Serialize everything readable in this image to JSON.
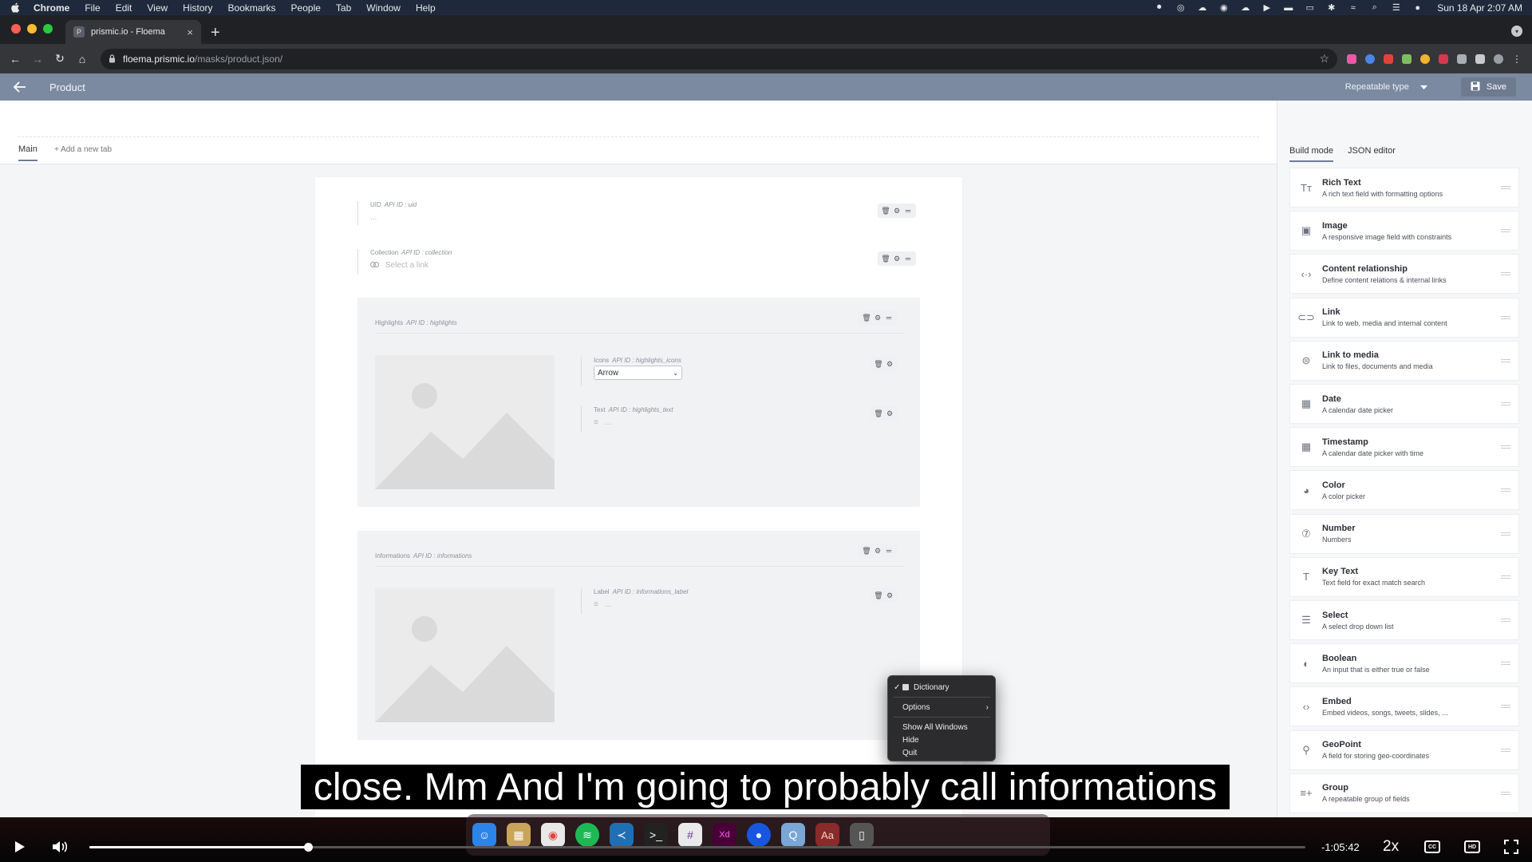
{
  "menubar": {
    "app": "Chrome",
    "items": [
      "File",
      "Edit",
      "View",
      "History",
      "Bookmarks",
      "People",
      "Tab",
      "Window",
      "Help"
    ],
    "clock": "Sun 18 Apr  2:07 AM"
  },
  "browser": {
    "tab_title": "prismic.io - Floema",
    "url_host": "floema.prismic.io",
    "url_path": "/masks/product.json/"
  },
  "header": {
    "title": "Product",
    "type_selector": "Repeatable type",
    "save_label": "Save"
  },
  "editor_tabs": {
    "main": "Main",
    "add": "Add a new tab"
  },
  "fields": {
    "uid": {
      "label": "UID",
      "api": "API ID : uid",
      "value": "..."
    },
    "collection": {
      "label": "Collection",
      "api": "API ID : collection",
      "placeholder": "Select a link"
    },
    "highlights": {
      "label": "Highlights",
      "api": "API ID : highlights",
      "icons": {
        "label": "Icons",
        "api": "API ID : highlights_icons",
        "value": "Arrow"
      },
      "text": {
        "label": "Text",
        "api": "API ID : highlights_text",
        "value": "..."
      }
    },
    "informations": {
      "label": "Informations",
      "api": "API ID : informations",
      "label_field": {
        "label": "Label",
        "api": "API ID : informations_label",
        "value": "..."
      }
    }
  },
  "right_panel": {
    "tabs": [
      "Build mode",
      "JSON editor"
    ],
    "widgets": [
      {
        "name": "Rich Text",
        "desc": "A rich text field with formatting options",
        "icon": "rich-text-icon"
      },
      {
        "name": "Image",
        "desc": "A responsive image field with constraints",
        "icon": "image-icon"
      },
      {
        "name": "Content relationship",
        "desc": "Define content relations & internal links",
        "icon": "content-relationship-icon"
      },
      {
        "name": "Link",
        "desc": "Link to web, media and internal content",
        "icon": "link-icon"
      },
      {
        "name": "Link to media",
        "desc": "Link to files, documents and media",
        "icon": "link-media-icon"
      },
      {
        "name": "Date",
        "desc": "A calendar date picker",
        "icon": "calendar-icon"
      },
      {
        "name": "Timestamp",
        "desc": "A calendar date picker with time",
        "icon": "calendar-icon"
      },
      {
        "name": "Color",
        "desc": "A color picker",
        "icon": "palette-icon"
      },
      {
        "name": "Number",
        "desc": "Numbers",
        "icon": "number-icon"
      },
      {
        "name": "Key Text",
        "desc": "Text field for exact match search",
        "icon": "key-text-icon"
      },
      {
        "name": "Select",
        "desc": "A select drop down list",
        "icon": "select-icon"
      },
      {
        "name": "Boolean",
        "desc": "An input that is either true or false",
        "icon": "toggle-icon"
      },
      {
        "name": "Embed",
        "desc": "Embed videos, songs, tweets, slides, ...",
        "icon": "embed-icon"
      },
      {
        "name": "GeoPoint",
        "desc": "A field for storing geo-coordinates",
        "icon": "pin-icon"
      },
      {
        "name": "Group",
        "desc": "A repeatable group of fields",
        "icon": "group-icon"
      }
    ]
  },
  "context_menu": {
    "items": [
      "Dictionary",
      "Options",
      "Show All Windows",
      "Hide",
      "Quit"
    ]
  },
  "subtitle": "close. Mm And I'm going to probably call informations",
  "player": {
    "time_remaining": "-1:05:42",
    "speed": "2x",
    "progress_fraction": 0.18,
    "cc": "CC",
    "hd": "HD"
  },
  "colors": {
    "header": "#7b8aa0",
    "accent": "#6f7d93"
  }
}
